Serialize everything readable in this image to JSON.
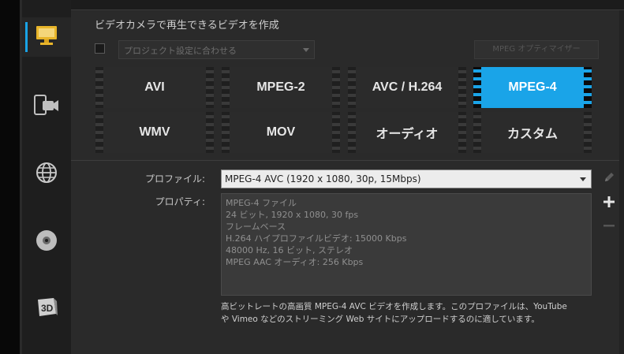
{
  "sidebar": {
    "items": [
      {
        "icon": "monitor-icon",
        "active": true
      },
      {
        "icon": "mobile-camera-icon",
        "active": false
      },
      {
        "icon": "globe-icon",
        "active": false
      },
      {
        "icon": "disc-icon",
        "active": false
      },
      {
        "icon": "3d-icon",
        "active": false
      }
    ]
  },
  "header": {
    "title": "ビデオカメラで再生できるビデオを作成",
    "project_select_placeholder": "プロジェクト設定に合わせる",
    "optimizer_label": "MPEG オプティマイザー"
  },
  "formats": {
    "row1": [
      "AVI",
      "MPEG-2",
      "AVC / H.264",
      "MPEG-4"
    ],
    "row2": [
      "WMV",
      "MOV",
      "オーディオ",
      "カスタム"
    ],
    "selected": "MPEG-4"
  },
  "profile": {
    "label": "プロファイル:",
    "value": "MPEG-4 AVC (1920 x 1080, 30p, 15Mbps)"
  },
  "properties": {
    "label": "プロパティ:",
    "lines": [
      "MPEG-4 ファイル",
      "24 ビット, 1920 x 1080, 30 fps",
      "フレームベース",
      "H.264 ハイプロファイルビデオ: 15000 Kbps",
      "48000 Hz, 16 ビット, ステレオ",
      "MPEG AAC オーディオ: 256 Kbps"
    ]
  },
  "description": {
    "line1": "高ビットレートの高画質 MPEG-4 AVC ビデオを作成します。このプロファイルは、YouTube",
    "line2": "や Vimeo などのストリーミング Web サイトにアップロードするのに適しています。"
  },
  "colors": {
    "accent": "#1aa4e8",
    "background": "#2a2a2a"
  }
}
